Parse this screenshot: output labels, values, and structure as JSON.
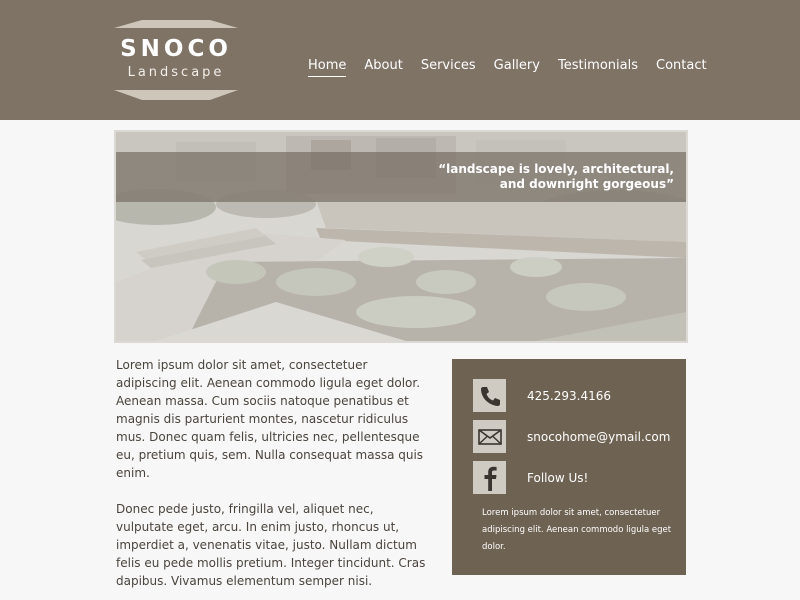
{
  "brand": {
    "title": "SNOCO",
    "subtitle": "Landscape"
  },
  "nav": [
    {
      "label": "Home",
      "active": true
    },
    {
      "label": "About"
    },
    {
      "label": "Services"
    },
    {
      "label": "Gallery"
    },
    {
      "label": "Testimonials"
    },
    {
      "label": "Contact"
    }
  ],
  "hero": {
    "quote_line1": "“landscape is lovely, architectural,",
    "quote_line2": "and downright gorgeous”"
  },
  "content": {
    "paragraph1": "Lorem ipsum dolor sit amet, consectetuer adipiscing elit. Aenean commodo ligula eget dolor. Aenean massa. Cum sociis natoque penatibus et magnis dis parturient montes, nascetur ridiculus mus. Donec quam felis, ultricies nec, pellentesque eu, pretium quis, sem. Nulla consequat massa quis enim.",
    "paragraph2": "Donec pede justo, fringilla vel, aliquet nec, vulputate eget, arcu. In enim justo, rhoncus ut, imperdiet a, venenatis vitae, justo. Nullam dictum felis eu pede mollis pretium. Integer tincidunt. Cras dapibus. Vivamus elementum semper nisi."
  },
  "contact": {
    "phone": "425.293.4166",
    "email": "snocohome@ymail.com",
    "social": "Follow Us!",
    "note": "Lorem ipsum dolor sit amet, consectetuer adipiscing elit. Aenean commodo ligula eget dolor.",
    "icons": {
      "phone": "phone-icon",
      "email": "envelope-icon",
      "social": "facebook-icon"
    }
  },
  "colors": {
    "header": "#7f7366",
    "contact_box": "#6e6252",
    "background": "#f7f7f7",
    "icon_tile": "#cfcac2"
  }
}
